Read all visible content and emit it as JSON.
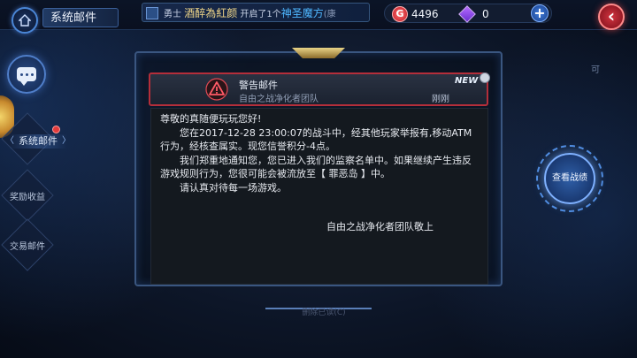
{
  "header": {
    "title": "系统邮件",
    "announcement": {
      "prefix": "勇士",
      "player": "酒醉為紅颜",
      "middle": "开启了1个",
      "item": "神圣魔方",
      "tail": "(康"
    },
    "currency": {
      "coin_symbol": "G",
      "coins": "4496",
      "gems": "0"
    },
    "plus_label": "+",
    "back_label": "‹"
  },
  "corner_text": "可",
  "sidebar": {
    "items": [
      {
        "label": "系统邮件",
        "active": true
      },
      {
        "label": "奖励收益",
        "active": false
      },
      {
        "label": "交易邮件",
        "active": false
      }
    ]
  },
  "mail": {
    "subject": "警告邮件",
    "sender": "自由之战净化者团队",
    "time": "刚刚",
    "new_badge": "NEW",
    "body": [
      "尊敬的真随便玩玩您好!",
      "您在2017-12-28   23:00:07的战斗中，经其他玩家举报有,移动ATM行为，经核查属实。现您信誉积分-4点。",
      "我们郑重地通知您，您已进入我们的监察名单中。如果继续产生违反游戏规则行为，您很可能会被流放至【 罪恶岛 】中。",
      "请认真对待每一场游戏。"
    ],
    "signature": "自由之战净化者团队敬上"
  },
  "bottom_label": "删除已读(C)",
  "actions": {
    "view_record": "查看战绩"
  },
  "colors": {
    "alert_red": "#b42e3a",
    "accent_blue": "#4f8ce0"
  }
}
